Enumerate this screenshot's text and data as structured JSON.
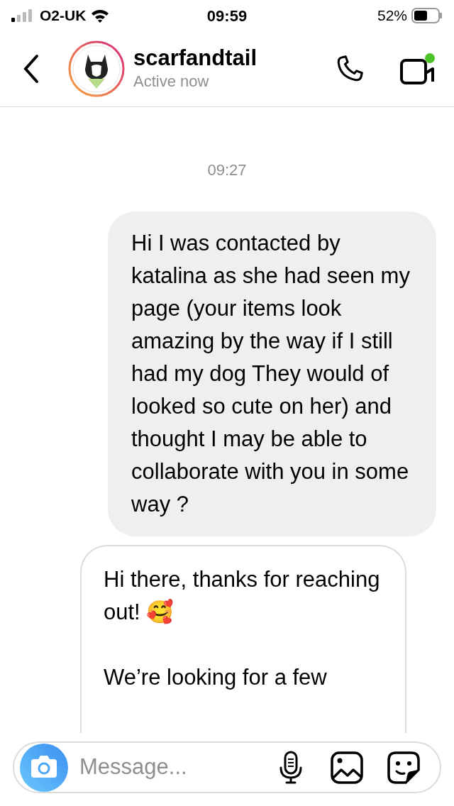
{
  "status_bar": {
    "carrier": "O2-UK",
    "time": "09:59",
    "battery": "52%"
  },
  "header": {
    "username": "scarfandtail",
    "status": "Active now"
  },
  "timestamp": "09:27",
  "messages": [
    {
      "kind": "outgoing",
      "text": "Hi I was contacted by katalina as she had seen my page (your items look amazing by the way if I still had my dog They would of looked so cute on her) and thought I may be able to collaborate with you in some way ?"
    },
    {
      "kind": "incoming",
      "text": "Hi there, thanks for reaching out! 🥰\n\nWe’re looking for a few"
    }
  ],
  "composer": {
    "placeholder": "Message..."
  }
}
